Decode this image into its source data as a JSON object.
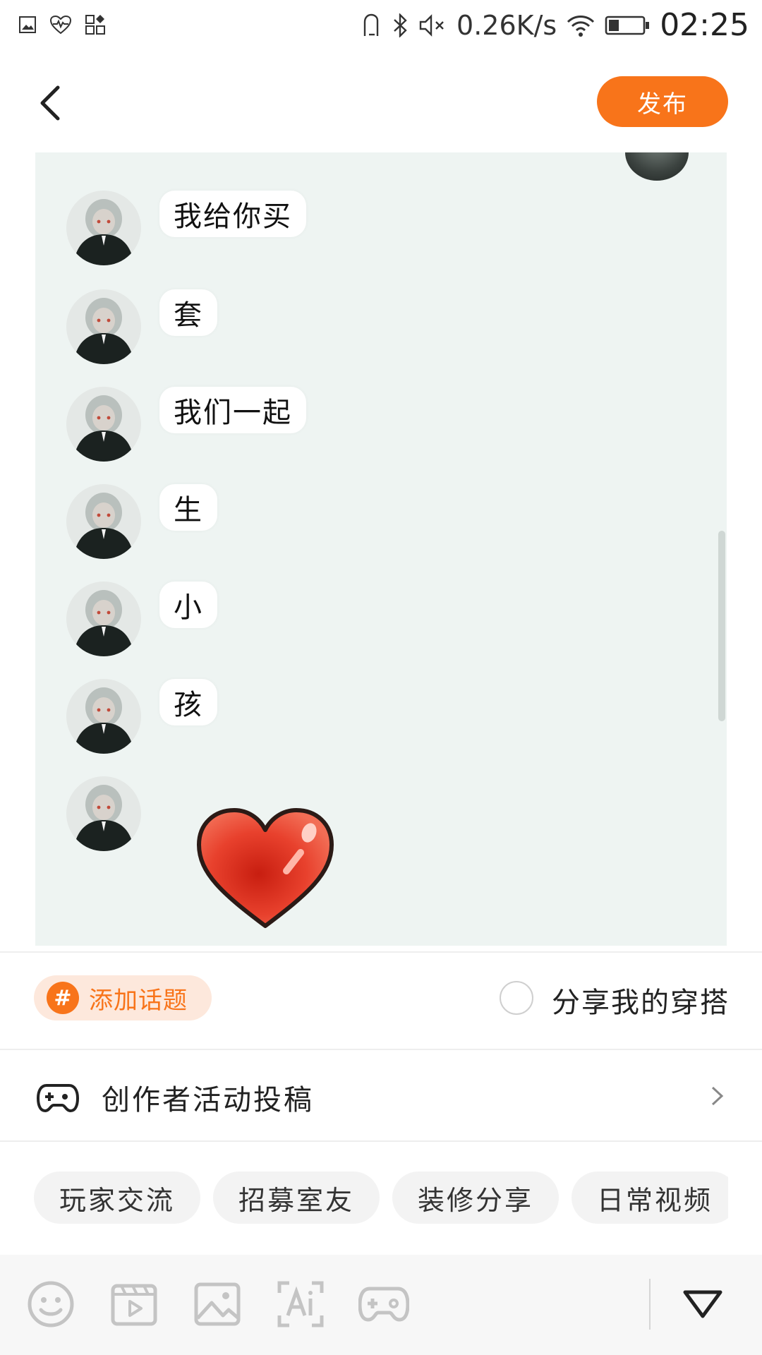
{
  "status_bar": {
    "network_speed": "0.26K/s",
    "time": "02:25"
  },
  "header": {
    "publish_label": "发布"
  },
  "chat_image": {
    "messages": [
      "我给你买",
      "套",
      "我们一起",
      "生",
      "小",
      "孩"
    ]
  },
  "topic": {
    "hash_symbol": "#",
    "add_topic_label": "添加话题"
  },
  "share": {
    "label": "分享我的穿搭"
  },
  "creator": {
    "label": "创作者活动投稿"
  },
  "tags": [
    "玩家交流",
    "招募室友",
    "装修分享",
    "日常视频"
  ],
  "colors": {
    "accent": "#f8741a",
    "topic_bg": "#fde8dc",
    "image_bg": "#eef4f2"
  }
}
